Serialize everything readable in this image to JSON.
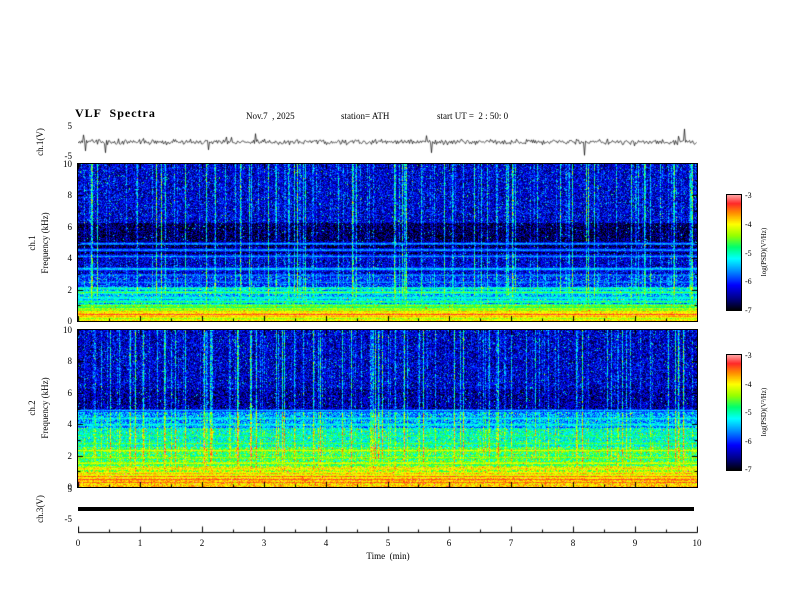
{
  "figure": {
    "title": "VLF  Spectra",
    "date": "Nov.7  , 2025",
    "station": "station= ATH",
    "start_ut": "start UT =  2 : 50: 0"
  },
  "axes": {
    "time": {
      "label": "Time  (min)",
      "ticks": [
        "0",
        "1",
        "2",
        "3",
        "4",
        "5",
        "6",
        "7",
        "8",
        "9",
        "10"
      ]
    },
    "wave1": {
      "label": "ch.1(V)",
      "tick_top": "5",
      "tick_bottom": "-5"
    },
    "spec1": {
      "label_line1": "ch.1",
      "label_line2": "Frequency  (kHz)",
      "ticks": [
        "10",
        "8",
        "6",
        "4",
        "2",
        "0"
      ]
    },
    "spec2": {
      "label_line1": "ch.2",
      "label_line2": "Frequency  (kHz)",
      "ticks": [
        "10",
        "8",
        "6",
        "4",
        "2",
        "0"
      ]
    },
    "wave3": {
      "label": "ch.3(V)",
      "tick_top": "5",
      "tick_bottom": "-5"
    },
    "colorbar": {
      "label": "log(PSD)(V²/Hz)",
      "ticks": [
        "-3",
        "-4",
        "-5",
        "-6",
        "-7"
      ]
    }
  },
  "chart_data": [
    {
      "type": "line",
      "name": "ch1-voltage",
      "ylabel": "ch.1(V)",
      "xlabel": "Time (min)",
      "xlim": [
        0,
        10
      ],
      "ylim": [
        -5,
        5
      ],
      "baseline_v": 0,
      "noise_amplitude_v": 1.0,
      "spike_amplitude_v": 4.5,
      "color": "#000000",
      "description": "broadband noisy voltage trace around 0 V with frequent impulsive spikes up to about ±4.5 V"
    },
    {
      "type": "heatmap",
      "name": "ch1-spectrogram",
      "xlabel": "Time (min)",
      "ylabel": "ch.1 Frequency (kHz)",
      "zlabel": "log(PSD)(V²/Hz)",
      "xlim": [
        0,
        10
      ],
      "ylim": [
        0,
        10
      ],
      "zlim": [
        -7,
        -3
      ],
      "background_bands": [
        {
          "f": [
            6.3,
            10.01
          ],
          "level": -6.3
        },
        {
          "f": [
            4.3,
            6.3
          ],
          "level": -6.75
        },
        {
          "f": [
            3.0,
            4.3
          ],
          "level": -6.35
        },
        {
          "f": [
            2.2,
            3.0
          ],
          "level": -6.0
        },
        {
          "f": [
            1.1,
            2.2
          ],
          "level": -5.5
        },
        {
          "f": [
            0.0,
            1.1
          ],
          "level": -5.0
        }
      ],
      "spectral_lines": [
        {
          "f": 4.95,
          "level": -5.4
        },
        {
          "f": 4.55,
          "level": -5.4
        },
        {
          "f": 4.15,
          "level": -5.5
        },
        {
          "f": 3.35,
          "level": -5.2
        },
        {
          "f": 2.95,
          "level": -5.6
        },
        {
          "f": 2.5,
          "level": -5.6
        },
        {
          "f": 2.1,
          "level": -4.9
        },
        {
          "f": 1.85,
          "level": -4.6
        },
        {
          "f": 1.5,
          "level": -4.9
        },
        {
          "f": 1.25,
          "level": -4.6
        },
        {
          "f": 1.0,
          "level": -4.3
        },
        {
          "f": 0.8,
          "level": -4.1
        },
        {
          "f": 0.62,
          "level": -3.7
        },
        {
          "f": 0.45,
          "level": -3.3
        },
        {
          "f": 0.3,
          "level": -3.6
        },
        {
          "f": 0.15,
          "level": -4.0
        },
        {
          "f": 0.05,
          "level": -3.8
        }
      ],
      "streaks": {
        "density": 0.38,
        "strength": 2.2,
        "min_f": 0.8,
        "description": "dense vertical cyan-green sferic streaks over dark blue background, strongest 2-10 kHz"
      }
    },
    {
      "type": "heatmap",
      "name": "ch2-spectrogram",
      "xlabel": "Time (min)",
      "ylabel": "ch.2 Frequency (kHz)",
      "zlabel": "log(PSD)(V²/Hz)",
      "xlim": [
        0,
        10
      ],
      "ylim": [
        0,
        10
      ],
      "zlim": [
        -7,
        -3
      ],
      "background_bands": [
        {
          "f": [
            6.3,
            10.01
          ],
          "level": -6.35
        },
        {
          "f": [
            4.8,
            6.3
          ],
          "level": -6.5
        },
        {
          "f": [
            3.8,
            4.8
          ],
          "level": -5.6
        },
        {
          "f": [
            2.6,
            3.8
          ],
          "level": -5.1
        },
        {
          "f": [
            1.4,
            2.6
          ],
          "level": -4.75
        },
        {
          "f": [
            0.6,
            1.4
          ],
          "level": -4.3
        },
        {
          "f": [
            0.0,
            0.6
          ],
          "level": -3.95
        }
      ],
      "spectral_lines": [
        {
          "f": 4.9,
          "level": -5.4
        },
        {
          "f": 4.4,
          "level": -5.1
        },
        {
          "f": 4.0,
          "level": -5.0
        },
        {
          "f": 3.3,
          "level": -4.8
        },
        {
          "f": 2.8,
          "level": -4.6
        },
        {
          "f": 2.35,
          "level": -4.1
        },
        {
          "f": 1.9,
          "level": -4.3
        },
        {
          "f": 1.55,
          "level": -4.0
        },
        {
          "f": 1.2,
          "level": -3.8
        },
        {
          "f": 0.9,
          "level": -3.7
        },
        {
          "f": 0.7,
          "level": -3.5
        },
        {
          "f": 0.5,
          "level": -3.35
        },
        {
          "f": 0.32,
          "level": -3.5
        },
        {
          "f": 0.15,
          "level": -3.8
        },
        {
          "f": 0.05,
          "level": -3.7
        }
      ],
      "streaks": {
        "density": 0.38,
        "strength": 2.2,
        "min_f": 0.8,
        "description": "vertical sferic streaks over blue upper half; lower half green-yellow with red power-line harmonics"
      }
    },
    {
      "type": "line",
      "name": "ch3-voltage",
      "ylabel": "ch.3(V)",
      "xlabel": "Time (min)",
      "xlim": [
        0,
        10
      ],
      "ylim": [
        -5,
        5
      ],
      "constant_v": 0,
      "color": "#000000",
      "description": "flat thick black trace at 0 V (channel inactive)"
    }
  ]
}
